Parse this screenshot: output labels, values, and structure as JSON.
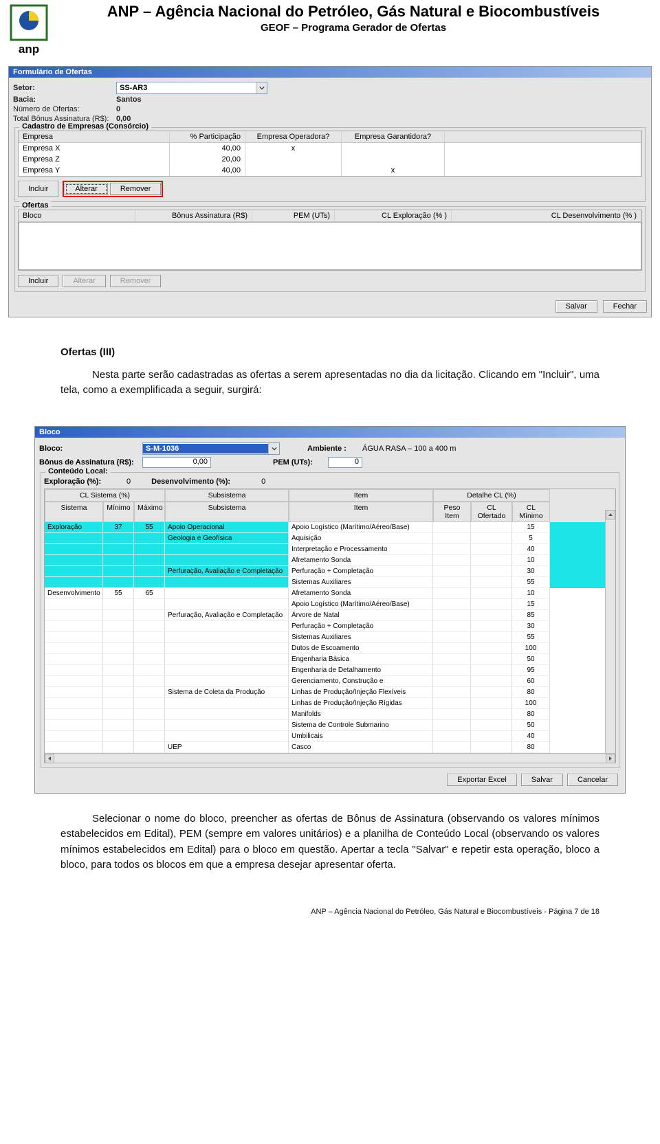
{
  "header": {
    "title": "ANP – Agência Nacional do Petróleo, Gás Natural e Biocombustíveis",
    "subtitle": "GEOF – Programa Gerador de Ofertas"
  },
  "window1": {
    "title": "Formulário de Ofertas",
    "labels": {
      "setor": "Setor:",
      "bacia": "Bacia:",
      "numofertas": "Número de Ofertas:",
      "totalbonus": "Total Bônus Assinatura (R$):"
    },
    "values": {
      "setor": "SS-AR3",
      "bacia": "Santos",
      "numofertas": "0",
      "totalbonus": "0,00"
    },
    "consorcio": {
      "legend": "Cadastro de Empresas (Consórcio)",
      "headers": {
        "empresa": "Empresa",
        "pct": "% Participação",
        "op": "Empresa Operadora?",
        "gar": "Empresa Garantidora?"
      },
      "rows": [
        {
          "empresa": "Empresa X",
          "pct": "40,00",
          "op": "x",
          "gar": ""
        },
        {
          "empresa": "Empresa Z",
          "pct": "20,00",
          "op": "",
          "gar": ""
        },
        {
          "empresa": "Empresa Y",
          "pct": "40,00",
          "op": "",
          "gar": "x"
        }
      ],
      "buttons": {
        "incluir": "Incluir",
        "alterar": "Alterar",
        "remover": "Remover"
      }
    },
    "ofertas": {
      "legend": "Ofertas",
      "headers": {
        "bloco": "Bloco",
        "bonus": "Bônus Assinatura (R$)",
        "pem": "PEM (UTs)",
        "clex": "CL Exploração (% )",
        "cldes": "CL Desenvolvimento (% )"
      },
      "buttons": {
        "incluir": "Incluir",
        "alterar": "Alterar",
        "remover": "Remover"
      }
    },
    "footer_buttons": {
      "salvar": "Salvar",
      "fechar": "Fechar"
    }
  },
  "body": {
    "heading": "Ofertas (III)",
    "p1": "Nesta parte serão cadastradas as ofertas a serem apresentadas no dia da licitação. Clicando em \"Incluir\", uma tela, como a exemplificada a seguir, surgirá:",
    "p2": "Selecionar o nome do bloco, preencher as ofertas de Bônus de Assinatura (observando os valores mínimos estabelecidos em Edital), PEM (sempre em valores unitários) e a planilha de Conteúdo Local (observando os valores mínimos estabelecidos em Edital) para o bloco em questão. Apertar a tecla \"Salvar\" e repetir esta operação, bloco a bloco, para todos os blocos em que a empresa desejar apresentar oferta."
  },
  "window2": {
    "title": "Bloco",
    "labels": {
      "bloco": "Bloco:",
      "ambiente": "Ambiente :",
      "bonus": "Bônus de Assinatura (R$):",
      "pem": "PEM (UTs):",
      "conteudo": "Conteúdo Local:",
      "exploracao": "Exploração (%):",
      "desenv": "Desenvolvimento (%):"
    },
    "values": {
      "bloco": "S-M-1036",
      "ambiente": "ÁGUA RASA – 100 a 400 m",
      "bonus": "0,00",
      "pem": "0",
      "exploracao_pct": "0",
      "desenv_pct": "0"
    },
    "grid": {
      "top_groups": {
        "sistema": "CL Sistema (%)",
        "subsistema": "Subsistema",
        "item": "Item",
        "detalhe": "Detalhe CL (%)"
      },
      "headers": {
        "sistema": "Sistema",
        "minimo": "Mínimo",
        "maximo": "Máximo",
        "subsistema": "Subsistema",
        "item": "Item",
        "peso": "Peso Item",
        "ofertado": "CL Ofertado",
        "clmin": "CL Mínimo"
      },
      "rows_exploracao": {
        "system": "Exploração",
        "min": "37",
        "max": "55",
        "subrows": [
          {
            "sub": "Apoio Operacional",
            "item": "Apoio Logístico (Marítimo/Aéreo/Base)",
            "clmin": "15"
          },
          {
            "sub": "Geologia e Geofísica",
            "item": "Aquisição",
            "clmin": "5"
          },
          {
            "sub": "",
            "item": "Interpretação e Processamento",
            "clmin": "40"
          },
          {
            "sub": "",
            "item": "Afretamento Sonda",
            "clmin": "10"
          },
          {
            "sub": "Perfuração, Avaliação e Completação",
            "item": "Perfuração + Completação",
            "clmin": "30"
          },
          {
            "sub": "",
            "item": "Sistemas Auxiliares",
            "clmin": "55"
          }
        ]
      },
      "rows_desenv": {
        "system": "Desenvolvimento",
        "min": "55",
        "max": "65",
        "subrows": [
          {
            "sub": "",
            "item": "Afretamento Sonda",
            "clmin": "10"
          },
          {
            "sub": "",
            "item": "Apoio Logístico (Marítimo/Aéreo/Base)",
            "clmin": "15"
          },
          {
            "sub": "Perfuração, Avaliação e Completação",
            "item": "Árvore de Natal",
            "clmin": "85"
          },
          {
            "sub": "",
            "item": "Perfuração + Completação",
            "clmin": "30"
          },
          {
            "sub": "",
            "item": "Sistemas Auxiliares",
            "clmin": "55"
          },
          {
            "sub": "",
            "item": "Dutos de Escoamento",
            "clmin": "100"
          },
          {
            "sub": "",
            "item": "Engenharia Básica",
            "clmin": "50"
          },
          {
            "sub": "",
            "item": "Engenharia de Detalhamento",
            "clmin": "95"
          },
          {
            "sub": "",
            "item": "Gerenciamento, Construção e",
            "clmin": "60"
          },
          {
            "sub": "Sistema de Coleta da Produção",
            "item": "Linhas de Produção/Injeção Flexíveis",
            "clmin": "80"
          },
          {
            "sub": "",
            "item": "Linhas de Produção/Injeção Rígidas",
            "clmin": "100"
          },
          {
            "sub": "",
            "item": "Manifolds",
            "clmin": "80"
          },
          {
            "sub": "",
            "item": "Sistema de Controle Submarino",
            "clmin": "50"
          },
          {
            "sub": "",
            "item": "Umbilicais",
            "clmin": "40"
          },
          {
            "sub": "UEP",
            "item": "Casco",
            "clmin": "80"
          }
        ]
      }
    },
    "buttons": {
      "exportar": "Exportar Excel",
      "salvar": "Salvar",
      "cancelar": "Cancelar"
    }
  },
  "footer": "ANP – Agência Nacional do Petróleo, Gás Natural e Biocombustíveis - Página 7 de 18"
}
